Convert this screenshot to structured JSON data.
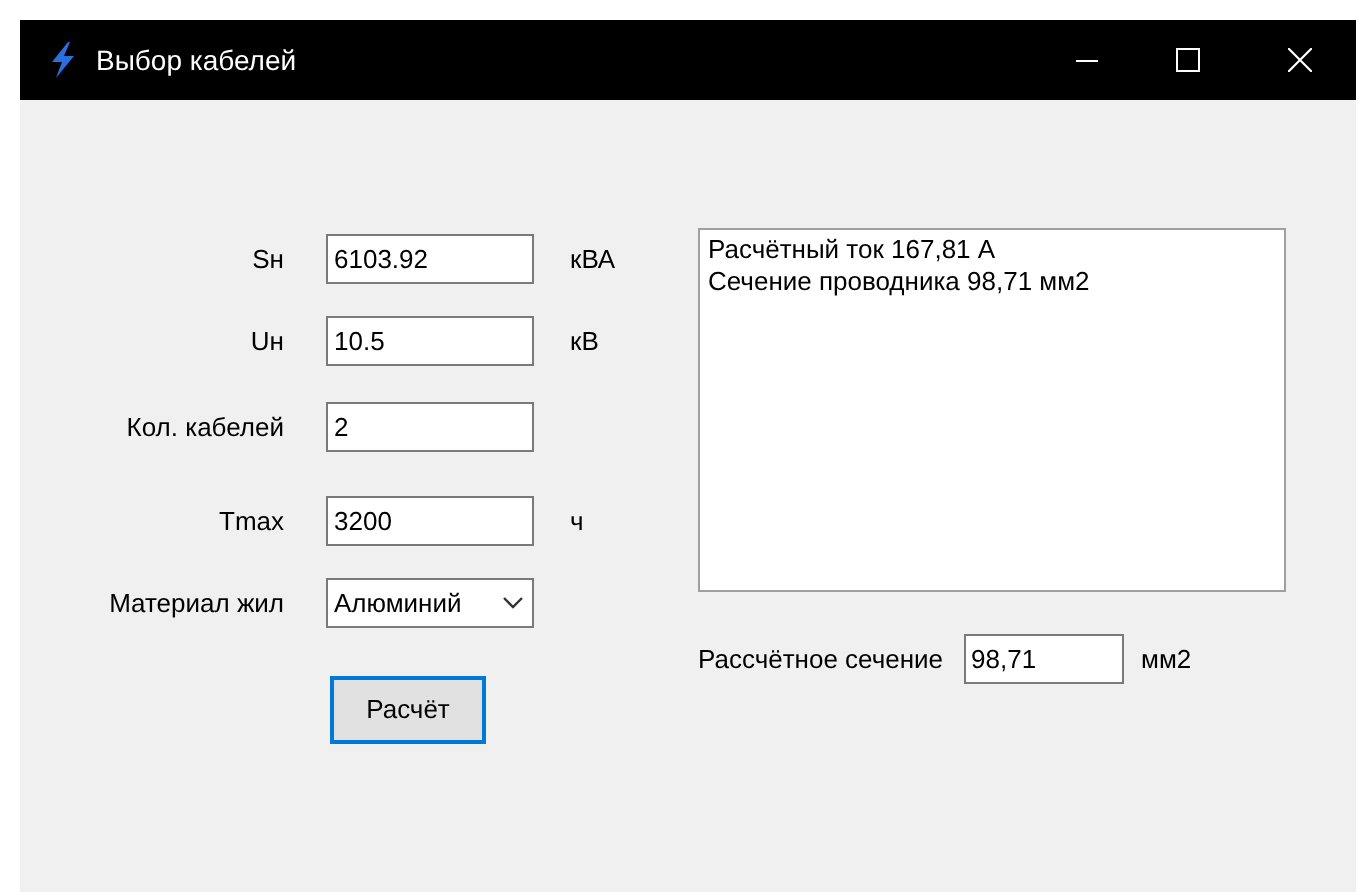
{
  "window": {
    "title": "Выбор кабелей"
  },
  "fields": [
    {
      "kind": "text",
      "label": "Sн",
      "value": "6103.92",
      "unit": "кВА"
    },
    {
      "kind": "text",
      "label": "Uн",
      "value": "10.5",
      "unit": "кВ"
    },
    {
      "kind": "text",
      "label": "Кол. кабелей",
      "value": "2"
    },
    {
      "kind": "text",
      "label": "Tmax",
      "value": "3200",
      "unit": "ч"
    },
    {
      "kind": "combo",
      "label": "Материал жил",
      "value": "Алюминий"
    }
  ],
  "button": "Расчёт",
  "output_lines": [
    "Расчётный ток 167,81 А",
    "Сечение проводника 98,71 мм2"
  ],
  "result": {
    "label": "Рассчётное сечение",
    "value": "98,71",
    "unit": "мм2"
  }
}
